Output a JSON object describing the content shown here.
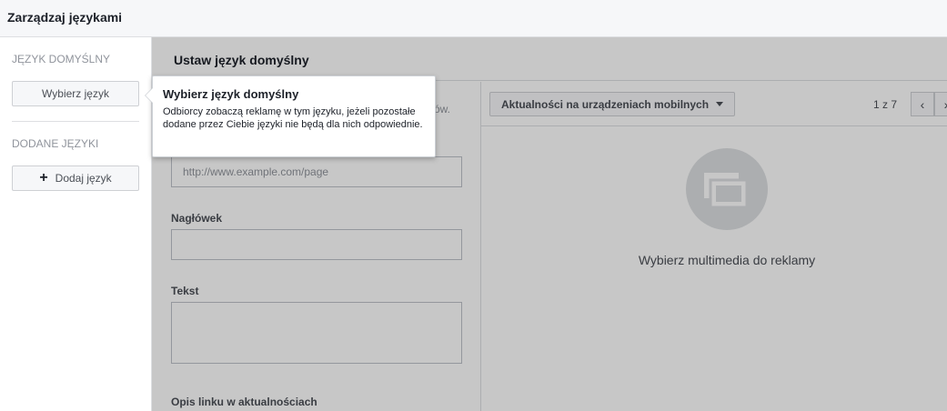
{
  "window": {
    "title": "Zarządzaj językami"
  },
  "sidebar": {
    "default_heading": "JĘZYK DOMYŚLNY",
    "choose_button": "Wybierz język",
    "added_heading": "DODANE JĘZYKI",
    "add_button": "Dodaj język",
    "add_icon": "+"
  },
  "main": {
    "title": "Ustaw język domyślny",
    "cut_text": "ów.",
    "url_placeholder": "http://www.example.com/page",
    "headline_label": "Nagłówek",
    "text_label": "Tekst",
    "link_desc_label": "Opis linku w aktualnościach"
  },
  "preview": {
    "placement": "Aktualności na urządzeniach mobilnych",
    "pager": "1 z 7",
    "prev_icon": "‹",
    "next_icon": "›",
    "media_text": "Wybierz multimedia do reklamy"
  },
  "tooltip": {
    "title": "Wybierz język domyślny",
    "body": "Odbiorcy zobaczą reklamę w tym języku, jeżeli pozostałe dodane przez Ciebie języki nie będą dla nich odpowiednie."
  },
  "colors": {
    "overlay": "#000000",
    "border": "#dddfe2",
    "text_primary": "#1d2129",
    "text_muted": "#90949c"
  }
}
